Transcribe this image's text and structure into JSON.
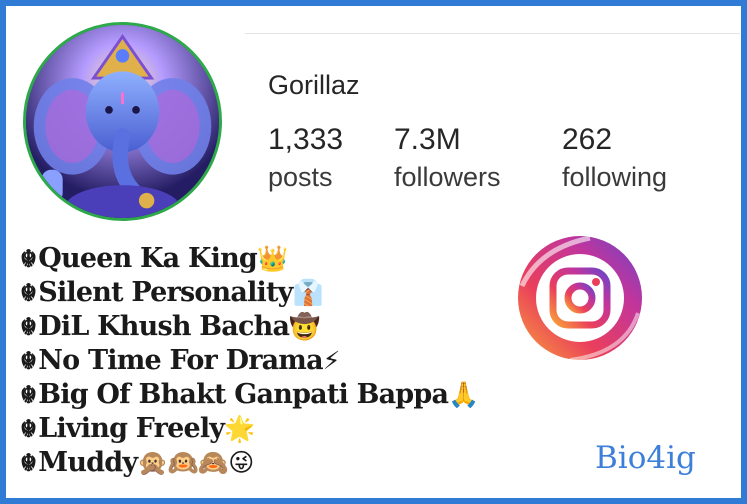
{
  "profile": {
    "username": "Gorillaz",
    "stats": [
      {
        "value": "1,333",
        "label": "posts"
      },
      {
        "value": "7.3M",
        "label": "followers"
      },
      {
        "value": "262",
        "label": "following"
      }
    ]
  },
  "bio": {
    "prefix_glyph": "☬",
    "lines": [
      {
        "text": "Queen Ka King",
        "emoji": "👑"
      },
      {
        "text": "Silent Personality",
        "emoji": "👔"
      },
      {
        "text": "DiL Khush Bacha",
        "emoji": "🤠"
      },
      {
        "text": "No Time For Drama",
        "emoji": "⚡"
      },
      {
        "text": "Big Of Bhakt Ganpati Bappa",
        "emoji": "🙏"
      },
      {
        "text": "Living Freely",
        "emoji": "🌟"
      },
      {
        "text": "Muddy",
        "emoji": "🙊🙉🙈😜"
      }
    ]
  },
  "icons": {
    "avatar": "ganesha-avatar",
    "brand": "instagram-icon"
  },
  "watermark": "Bio4ig",
  "colors": {
    "frame": "#2f7bd6",
    "avatar_border": "#2ea94a",
    "watermark": "#3d7fd9"
  }
}
